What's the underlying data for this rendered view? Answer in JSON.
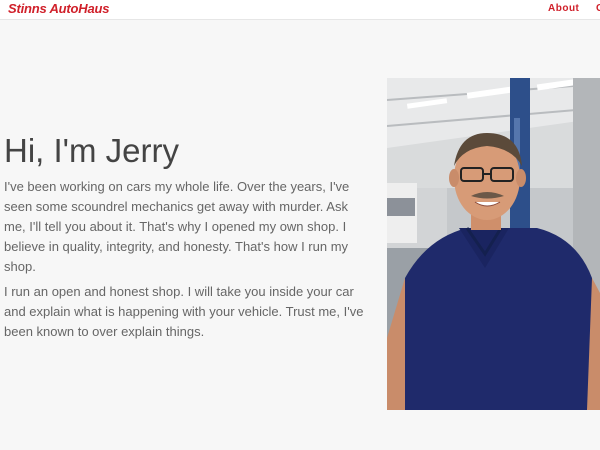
{
  "navbar": {
    "brand": "Stinns AutoHaus",
    "links": [
      "About",
      "C"
    ]
  },
  "hero": {
    "heading": "Hi, I'm Jerry",
    "paragraphs": [
      "I've been working on cars my whole life. Over the years, I've seen some scoundrel mechanics get away with murder. Ask me, I'll tell you about it. That's why I opened my own shop. I believe in quality, integrity, and honesty. That's how I run my shop.",
      "I run an open and honest shop. I will take you inside your car and explain what is happening with your vehicle. Trust me, I've been known to over explain things."
    ]
  },
  "icons": {
    "photo": "portrait-photo"
  },
  "colors": {
    "brand": "#d0202a",
    "heading": "#444444",
    "body_text": "#666666",
    "background": "#f7f7f7"
  }
}
